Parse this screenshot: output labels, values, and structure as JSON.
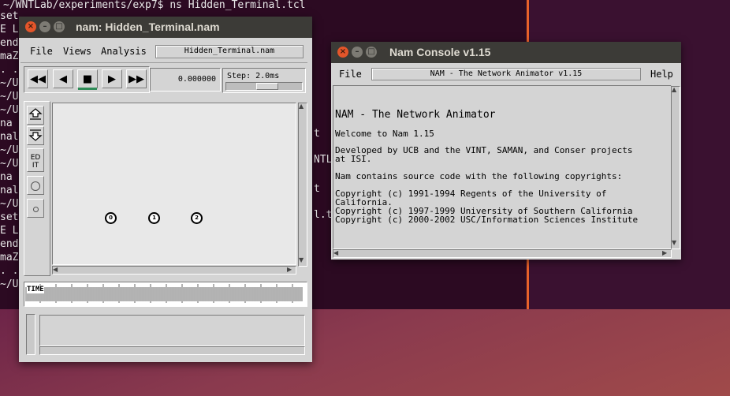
{
  "terminal": {
    "line1": "~/WNTLab/experiments/exp7$ ns Hidden_Terminal.tcl",
    "frags": [
      {
        "t": "set"
      },
      {
        "t": "E L"
      },
      {
        "t": "end"
      },
      {
        "t": "maZ"
      },
      {
        "t": ". ."
      },
      {
        "t": "~/U"
      },
      {
        "t": "~/U"
      },
      {
        "t": "~/U"
      },
      {
        "t": "na"
      },
      {
        "t": "nal"
      },
      {
        "t": "~/U"
      },
      {
        "t": "~/U"
      },
      {
        "t": "na"
      },
      {
        "t": "nal"
      },
      {
        "t": "~/U"
      },
      {
        "t": "set"
      },
      {
        "t": "E L"
      },
      {
        "t": "end"
      },
      {
        "t": "maZ"
      },
      {
        "t": ". ."
      },
      {
        "t": "~/U"
      }
    ],
    "right_frags": [
      "t",
      "NTLa",
      "t",
      "l.t"
    ]
  },
  "nam": {
    "title": "nam: Hidden_Terminal.nam",
    "menu": {
      "file": "File",
      "views": "Views",
      "analysis": "Analysis"
    },
    "filename": "Hidden_Terminal.nam",
    "time_value": "0.000000",
    "step_label": "Step: 2.0ms",
    "edit_label": "ED\nIT",
    "timeline_label": "TIME",
    "nodes": [
      {
        "label": "0"
      },
      {
        "label": "1"
      },
      {
        "label": "2"
      }
    ]
  },
  "console": {
    "title": "Nam Console v1.15",
    "menu_file": "File",
    "menu_help": "Help",
    "header_field": "NAM - The Network Animator v1.15",
    "heading": "NAM - The Network Animator",
    "welcome": "Welcome to Nam 1.15",
    "developed1": "Developed by UCB and the VINT, SAMAN, and Conser projects",
    "developed2": "at ISI.",
    "copyright_intro": "Nam contains source code with the following copyrights:",
    "copy1": "Copyright (c) 1991-1994 Regents of the University of",
    "copy1b": "California.",
    "copy2": "Copyright (c) 1997-1999 University of Southern California",
    "copy3": "Copyright (c) 2000-2002 USC/Information Sciences Institute"
  },
  "colors": {
    "close": "#e3552a",
    "titlebar": "#3c3b37",
    "terminal": "#2c0a22",
    "accent": "#e8622a"
  }
}
